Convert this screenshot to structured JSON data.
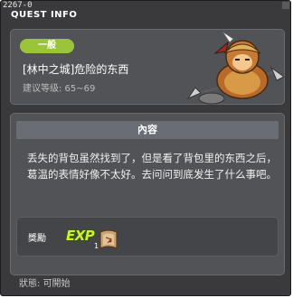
{
  "window": {
    "id_label": "2267-0",
    "title": "QUEST INFO"
  },
  "quest": {
    "category": "一般",
    "name": "[林中之城]危险的东西",
    "level": "建议等级: 65~69"
  },
  "content": {
    "header": "內容",
    "text": "丢失的背包虽然找到了，但是看了背包里的东西之后，葛温的表情好像不太好。去问问到底发生了什么事吧。"
  },
  "reward": {
    "label": "獎勵",
    "exp_text": "EXP",
    "item_count": "1"
  },
  "status": {
    "text": "狀態:  可開始"
  },
  "colors": {
    "category_bg": "#9bc43b",
    "exp_text": "#d6ef2c",
    "panel_bg": "#525356",
    "window_bg": "#3a3a3c"
  }
}
